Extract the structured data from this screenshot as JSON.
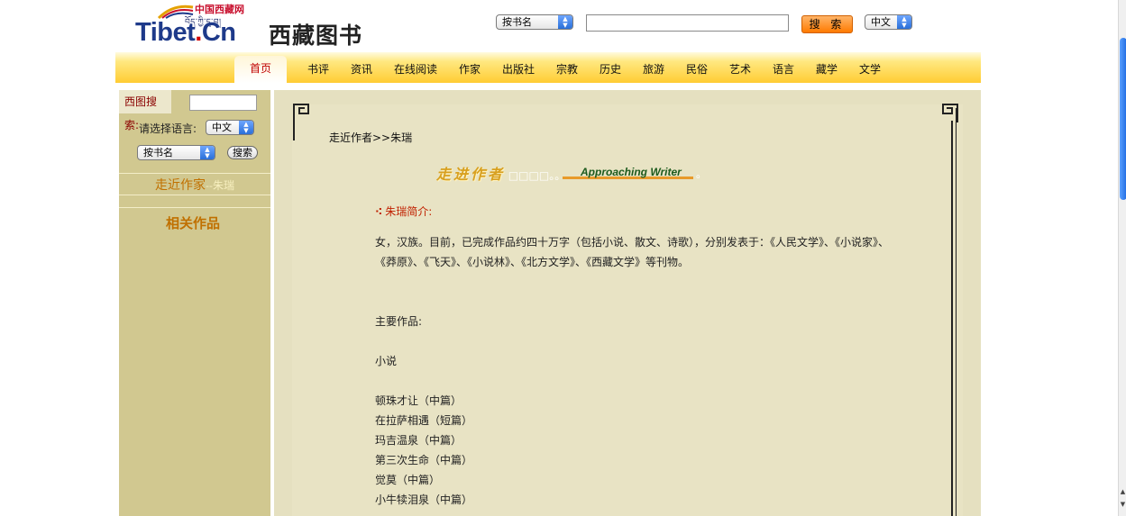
{
  "header": {
    "logo_cn": "中国西藏网",
    "logo_tibetan": "བོད་ཀྱི་དྲ་བ།",
    "logo_main": "Tibet",
    "logo_dot": ".",
    "logo_suffix": "Cn",
    "site_title": "西藏图书",
    "search_type": "按书名",
    "search_value": "",
    "search_button": "搜 索",
    "language": "中文"
  },
  "nav": {
    "home": "首页",
    "items": [
      "书评",
      "资讯",
      "在线阅读",
      "作家",
      "出版社",
      "宗教",
      "历史",
      "旅游",
      "民俗",
      "艺术",
      "语言",
      "藏学",
      "文学"
    ]
  },
  "sidebar": {
    "search_label": "西图搜索:",
    "lang_label": "请选择语言:",
    "lang_value": "中文",
    "type_value": "按书名",
    "search_btn": "搜索",
    "author_section": "走近作家",
    "author_sep": "--",
    "author_name": "朱瑞",
    "related": "相关作品"
  },
  "content": {
    "breadcrumb": "走近作者>>朱瑞",
    "banner_cn": "走进作者",
    "banner_dots": "□□□□。。",
    "banner_en": "Approaching Writer",
    "banner_end": "。",
    "section_title": "朱瑞简介:",
    "intro": "女，汉族。目前，已完成作品约四十万字（包括小说、散文、诗歌），分别发表于：《人民文学》、《小说家》、《莽原》、《飞天》、《小说林》、《北方文学》、《西藏文学》等刊物。",
    "works_label": "主要作品:",
    "category": "小说",
    "works": [
      "顿珠才让（中篇）",
      "在拉萨相遇（短篇）",
      "玛吉温泉（中篇）",
      "第三次生命（中篇）",
      "觉莫（中篇）",
      "小牛犊泪泉（中篇）"
    ]
  },
  "colors": {
    "nav_top": "#fffbe0",
    "nav_bottom": "#ffcc33",
    "sidebar": "#d1c890",
    "content": "#e5e0c0",
    "accent_orange": "#c07000",
    "home_red": "#c00000"
  }
}
